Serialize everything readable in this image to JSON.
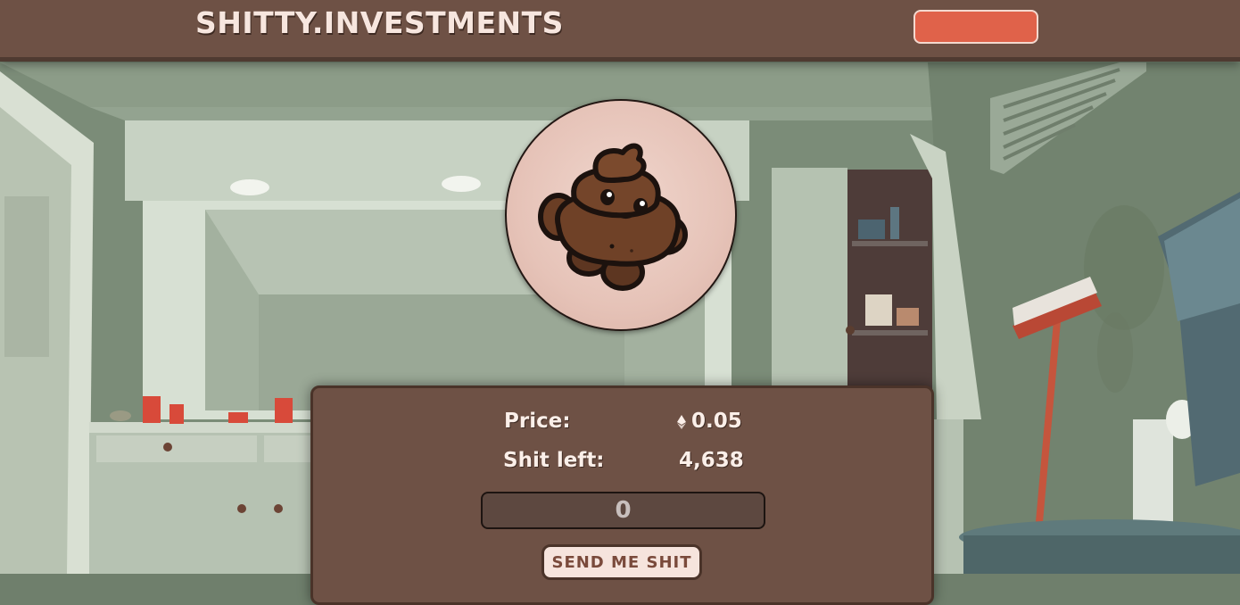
{
  "header": {
    "logo_text": "SHITTY.INVESTMENTS",
    "action_button_label": ""
  },
  "mint": {
    "price_label": "Price:",
    "price_value": "0.05",
    "price_currency_icon": "ethereum-icon",
    "supply_label": "Shit left:",
    "supply_value": "4,638",
    "quantity_placeholder": "0",
    "send_button_label": "SEND ME SHIT"
  },
  "colors": {
    "header_bg": "#6e5145",
    "accent_button": "#e0624a",
    "panel_bg": "#6e5145",
    "text_light": "#fbefe9"
  }
}
